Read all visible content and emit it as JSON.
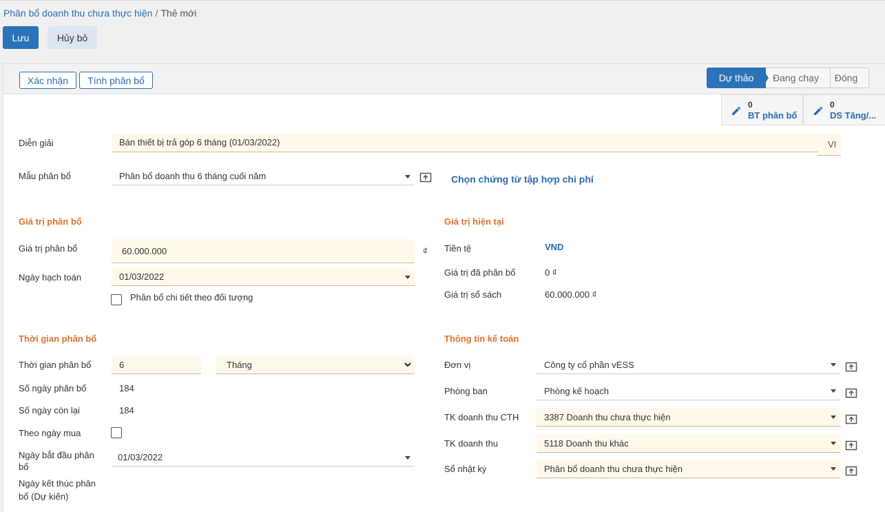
{
  "breadcrumb": {
    "parent": "Phân bổ doanh thu chưa thực hiện",
    "separator": "/",
    "current": "Thẻ mới"
  },
  "toolbar": {
    "save_label": "Lưu",
    "cancel_label": "Hủy bỏ"
  },
  "header": {
    "confirm_label": "Xác nhận",
    "compute_label": "Tính phân bổ",
    "statuses": [
      "Dự thảo",
      "Đang chạy",
      "Đóng"
    ],
    "active_status": "Dự thảo"
  },
  "smart_buttons": [
    {
      "count": "0",
      "label": "BT phân bổ",
      "icon": "pencil-icon"
    },
    {
      "count": "0",
      "label": "DS Tăng/...",
      "icon": "pencil-icon"
    }
  ],
  "form": {
    "description_label": "Diễn giải",
    "description_value": "Bán thiết bị trả góp 6 tháng (01/03/2022)",
    "lang_badge": "VI",
    "template_label": "Mẫu phân bổ",
    "template_value": "Phân bổ doanh thu 6 tháng cuối năm",
    "choose_link": "Chọn chứng từ tập hợp chi phí"
  },
  "alloc_value": {
    "title": "Giá trị phân bổ",
    "value_label": "Giá trị phân bổ",
    "value": "60.000.000",
    "currency_symbol": "₫",
    "date_label": "Ngày hạch toán",
    "date_value": "01/03/2022",
    "detail_checkbox_label": "Phân bổ chi tiết theo đối tượng"
  },
  "current_value": {
    "title": "Giá trị hiện tại",
    "currency_label": "Tiền tệ",
    "currency_value": "VND",
    "allocated_label": "Giá trị đã phân bổ",
    "allocated_value": "0 ₫",
    "book_label": "Giá trị sổ sách",
    "book_value": "60.000.000 ₫"
  },
  "alloc_time": {
    "title": "Thời gian phân bổ",
    "period_label": "Thời gian phân bổ",
    "period_value": "6",
    "period_unit": "Tháng",
    "days_label": "Số ngày phân bổ",
    "days_value": "184",
    "remaining_label": "Số ngày còn lại",
    "remaining_value": "184",
    "by_purchase_label": "Theo ngày mua",
    "start_label": "Ngày bắt đầu phân bổ",
    "start_value": "01/03/2022",
    "end_label": "Ngày kết thúc phân bổ (Dự kiến)"
  },
  "accounting": {
    "title": "Thông tin kế toán",
    "unit_label": "Đơn vị",
    "unit_value": "Công ty cổ phần vESS",
    "dept_label": "Phòng ban",
    "dept_value": "Phòng kế hoạch",
    "unearned_label": "TK doanh thu CTH",
    "unearned_value": "3387 Doanh thu chưa thực hiện",
    "revenue_label": "TK doanh thu",
    "revenue_value": "5118 Doanh thu khác",
    "journal_label": "Sổ nhật ký",
    "journal_value": "Phân bổ doanh thu chưa thực hiện"
  },
  "colors": {
    "primary": "#2a73b8",
    "section_title": "#e0702e",
    "input_bg": "#fff9ec",
    "link": "#2a6cb0"
  }
}
